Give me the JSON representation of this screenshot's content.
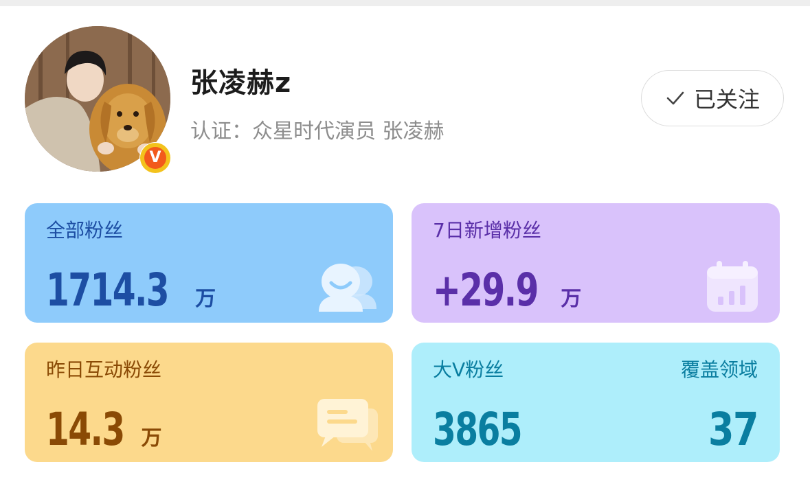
{
  "colors": {
    "card_fans_bg": "#8ecbfb",
    "card_fans_text": "#1d4ea3",
    "card_new_bg": "#d9c2fb",
    "card_new_text": "#5a2fa8",
    "card_interact_bg": "#fcd98c",
    "card_interact_text": "#8a4a05",
    "card_bigv_bg": "#aeeefb",
    "card_bigv_text": "#0a7ea0",
    "badge_outer": "#f3c21c",
    "badge_inner": "#f25a1c"
  },
  "profile": {
    "name": "张凌赫z",
    "certification": "认证：众星时代演员 张凌赫",
    "verified_badge": "V",
    "avatar_icon": "avatar-photo"
  },
  "follow_button": {
    "icon": "check-icon",
    "label": "已关注"
  },
  "stats": {
    "total_fans": {
      "label": "全部粉丝",
      "value": "1714.3",
      "unit": "万",
      "icon": "users-icon"
    },
    "new_fans_7d": {
      "label": "7日新增粉丝",
      "value": "+29.9",
      "unit": "万",
      "icon": "calendar-chart-icon"
    },
    "interact_fans_yesterday": {
      "label": "昨日互动粉丝",
      "value": "14.3",
      "unit": "万",
      "icon": "chat-bubbles-icon"
    },
    "bigv_fans": {
      "label": "大V粉丝",
      "value": "3865",
      "coverage_label": "覆盖领域",
      "coverage_value": "37"
    }
  }
}
